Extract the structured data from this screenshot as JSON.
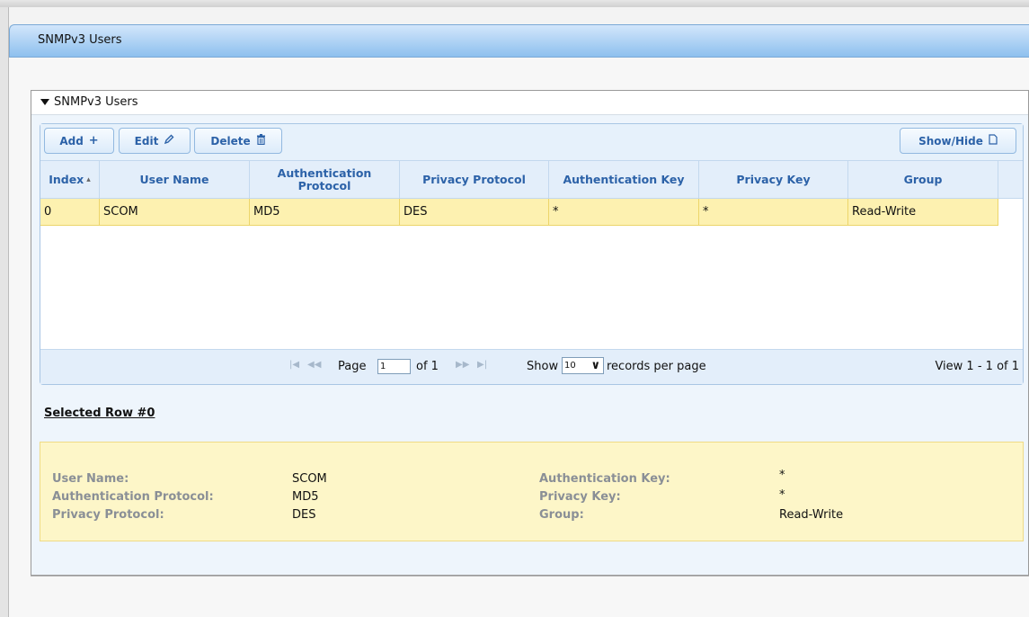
{
  "page": {
    "title": "SNMPv3 Users"
  },
  "panel": {
    "title": "SNMPv3 Users"
  },
  "toolbar": {
    "add_label": "Add",
    "edit_label": "Edit",
    "delete_label": "Delete",
    "showhide_label": "Show/Hide",
    "icons": {
      "add": "plus-icon",
      "edit": "pencil-icon",
      "delete": "trash-icon",
      "showhide": "document-icon"
    }
  },
  "table": {
    "columns": [
      "Index",
      "User Name",
      "Authentication Protocol",
      "Privacy Protocol",
      "Authentication Key",
      "Privacy Key",
      "Group"
    ],
    "rows": [
      [
        "0",
        "SCOM",
        "MD5",
        "DES",
        "*",
        "*",
        "Read-Write"
      ]
    ]
  },
  "pager": {
    "page_label": "Page",
    "page_value": "1",
    "of_label": "of 1",
    "show_label": "Show",
    "records_value": "10",
    "records_label": "records per page",
    "view_text": "View 1 - 1 of 1"
  },
  "selected": {
    "title": "Selected Row #0",
    "fields": [
      {
        "label": "User Name:",
        "value": "SCOM"
      },
      {
        "label": "Authentication Protocol:",
        "value": "MD5"
      },
      {
        "label": "Privacy Protocol:",
        "value": "DES"
      },
      {
        "label": "Authentication Key:",
        "value": "*"
      },
      {
        "label": "Privacy Key:",
        "value": "*"
      },
      {
        "label": "Group:",
        "value": "Read-Write"
      }
    ]
  },
  "colors": {
    "header_blue": "#8ec0ee",
    "link_blue": "#2c62a8",
    "selected_row": "#fdf1b0",
    "details_bg": "#fdf6c8"
  }
}
